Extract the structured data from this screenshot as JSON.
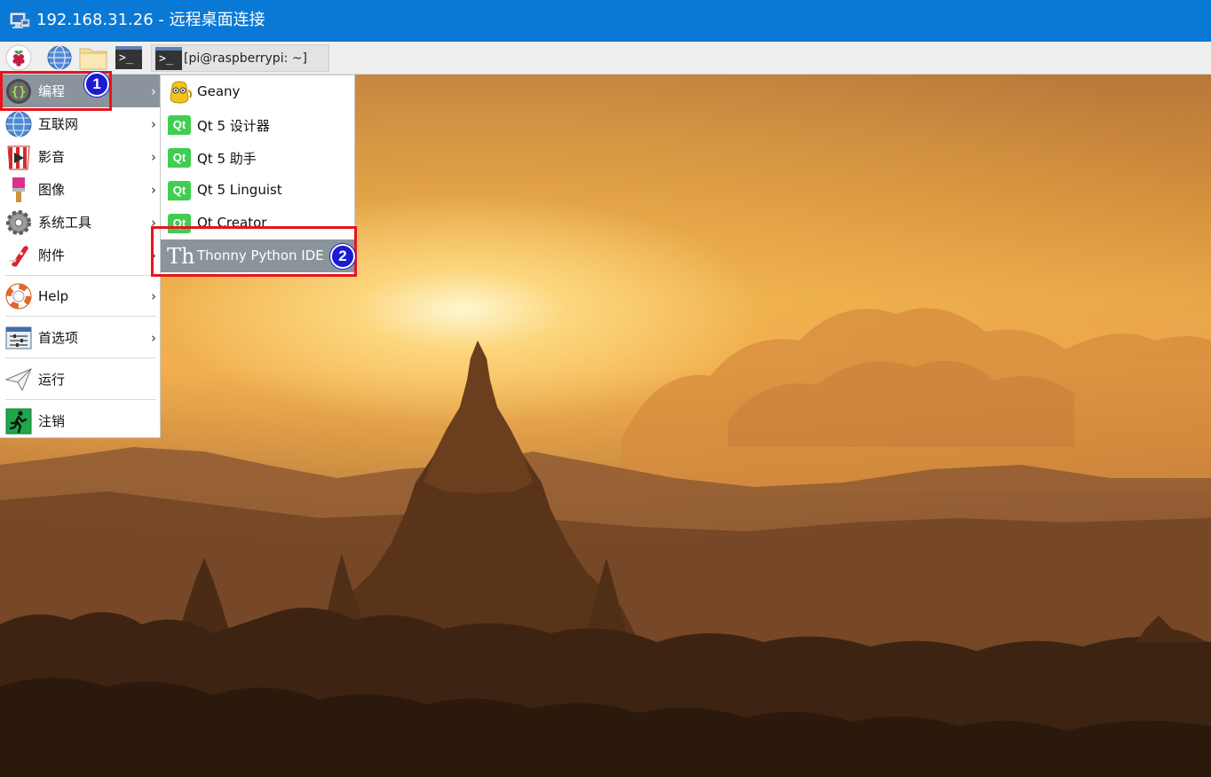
{
  "window": {
    "title": "192.168.31.26 - 远程桌面连接"
  },
  "panel": {
    "task_button_label": "[pi@raspberrypi: ~]",
    "terminal_glyph": ">_",
    "launchers": [
      "raspberry-menu-icon",
      "web-browser-icon",
      "file-manager-icon",
      "terminal-icon"
    ]
  },
  "main_menu": {
    "items": [
      {
        "label": "编程",
        "icon": "programming-braces-icon",
        "submenu": true
      },
      {
        "label": "互联网",
        "icon": "globe-icon",
        "submenu": true
      },
      {
        "label": "影音",
        "icon": "multimedia-icon",
        "submenu": true
      },
      {
        "label": "图像",
        "icon": "paint-brush-icon",
        "submenu": true
      },
      {
        "label": "系统工具",
        "icon": "gear-icon",
        "submenu": true
      },
      {
        "label": "附件",
        "icon": "pocket-knife-icon",
        "submenu": true
      },
      {
        "label": "Help",
        "icon": "lifebuoy-icon",
        "submenu": true
      },
      {
        "label": "首选项",
        "icon": "preferences-icon",
        "submenu": true
      },
      {
        "label": "运行",
        "icon": "paper-plane-icon",
        "submenu": false
      },
      {
        "label": "注销",
        "icon": "exit-icon",
        "submenu": false
      }
    ],
    "arrow": "›"
  },
  "sub_menu": {
    "items": [
      {
        "label": "Geany",
        "icon": "geany-icon"
      },
      {
        "label": "Qt 5 设计器",
        "icon": "qt-designer-icon"
      },
      {
        "label": "Qt 5 助手",
        "icon": "qt-assistant-icon"
      },
      {
        "label": "Qt 5 Linguist",
        "icon": "qt-linguist-icon"
      },
      {
        "label": "Qt Creator",
        "icon": "qt-creator-icon"
      },
      {
        "label": "Thonny Python IDE",
        "icon": "thonny-icon"
      }
    ],
    "qt_glyph": "Qt",
    "thonny_glyph": "Th"
  },
  "annotations": {
    "step1": "1",
    "step2": "2",
    "highlight_color": "#e8141c",
    "badge_color": "#1b1bd0"
  },
  "colors": {
    "titlebar": "#0a79d6",
    "menu_active": "#8b949c",
    "qt_green": "#41cd52"
  }
}
